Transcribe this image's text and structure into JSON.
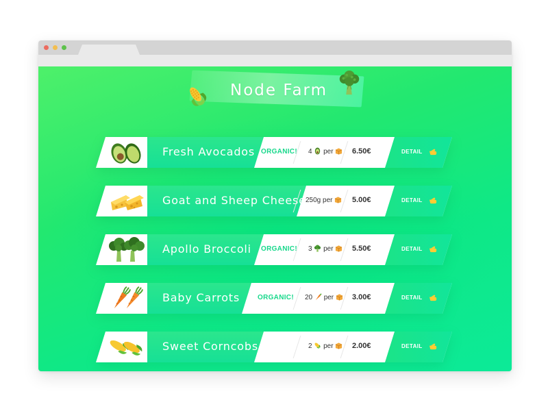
{
  "browser": {
    "window_controls": [
      "close",
      "minimize",
      "maximize"
    ],
    "tab_title": ""
  },
  "page": {
    "title": "Node Farm",
    "title_icons": [
      "corn-icon",
      "broccoli-icon"
    ],
    "colors": {
      "background_start": "#4ef06a",
      "background_end": "#0cea98",
      "accent": "#17d88b",
      "card": "#ffffff",
      "text_dark": "#333333"
    }
  },
  "products": [
    {
      "name": "Fresh Avocados",
      "image_icon": "avocado-icon",
      "organic": "ORGANIC!",
      "quantity_prefix": "4",
      "quantity_icon": "avocado-mini-icon",
      "quantity_suffix": "per",
      "box_icon": "box-icon",
      "price": "6.50€",
      "detail_label": "DETAIL",
      "detail_icon": "pointing-hand-icon"
    },
    {
      "name": "Goat and Sheep Cheese",
      "image_icon": "cheese-icon",
      "organic": "",
      "quantity_prefix": "250g",
      "quantity_icon": "",
      "quantity_suffix": "per",
      "box_icon": "box-icon",
      "price": "5.00€",
      "detail_label": "DETAIL",
      "detail_icon": "pointing-hand-icon"
    },
    {
      "name": "Apollo Broccoli",
      "image_icon": "broccoli-icon",
      "organic": "ORGANIC!",
      "quantity_prefix": "3",
      "quantity_icon": "broccoli-mini-icon",
      "quantity_suffix": "per",
      "box_icon": "box-icon",
      "price": "5.50€",
      "detail_label": "DETAIL",
      "detail_icon": "pointing-hand-icon"
    },
    {
      "name": "Baby Carrots",
      "image_icon": "carrot-icon",
      "organic": "ORGANIC!",
      "quantity_prefix": "20",
      "quantity_icon": "carrot-mini-icon",
      "quantity_suffix": "per",
      "box_icon": "box-icon",
      "price": "3.00€",
      "detail_label": "DETAIL",
      "detail_icon": "pointing-hand-icon"
    },
    {
      "name": "Sweet Corncobs",
      "image_icon": "corn-icon",
      "organic": "",
      "quantity_prefix": "2",
      "quantity_icon": "corn-mini-icon",
      "quantity_suffix": "per",
      "box_icon": "box-icon",
      "price": "2.00€",
      "detail_label": "DETAIL",
      "detail_icon": "pointing-hand-icon"
    }
  ]
}
